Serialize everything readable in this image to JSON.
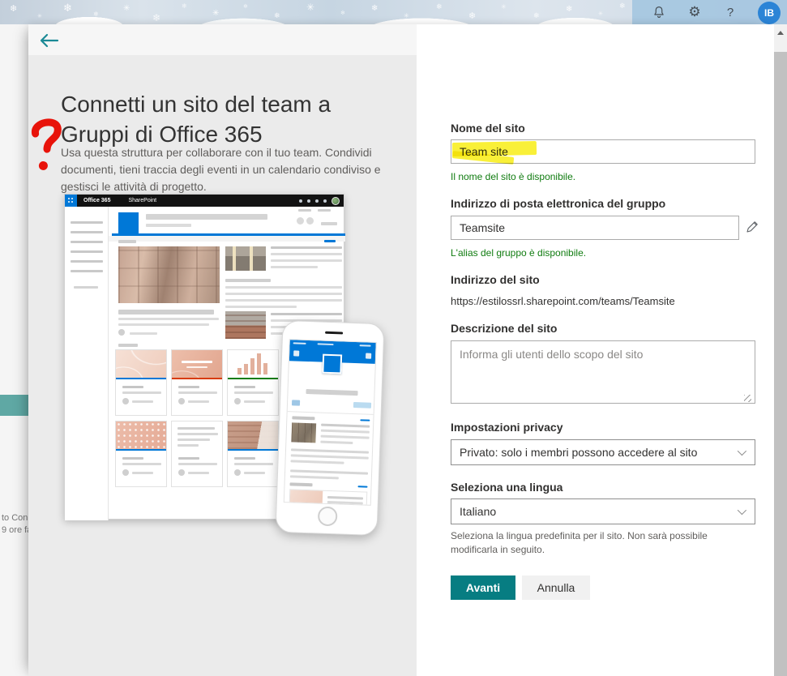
{
  "top_bar": {
    "help_label": "?",
    "avatar_initials": "IB",
    "icons": [
      "bell-icon",
      "gear-icon",
      "help-icon"
    ]
  },
  "background_page": {
    "peek_line1": "to Con",
    "peek_line2": "9 ore fa"
  },
  "left_panel": {
    "title": "Connetti un sito del team a Gruppi di Office 365",
    "description": "Usa questa struttura per collaborare con il tuo team. Condividi documenti, tieni traccia degli eventi in un calendario condiviso e gestisci le attività di progetto.",
    "preview": {
      "suite_label": "Office 365",
      "app_label": "SharePoint"
    }
  },
  "form": {
    "site_name": {
      "label": "Nome del sito",
      "value": "Team site",
      "validation": "Il nome del sito è disponibile."
    },
    "group_email": {
      "label": "Indirizzo di posta elettronica del gruppo",
      "value": "Teamsite",
      "validation": "L'alias del gruppo è disponibile."
    },
    "site_address": {
      "label": "Indirizzo del sito",
      "value": "https://estilossrl.sharepoint.com/teams/Teamsite"
    },
    "site_description": {
      "label": "Descrizione del sito",
      "placeholder": "Informa gli utenti dello scopo del sito"
    },
    "privacy": {
      "label": "Impostazioni privacy",
      "value": "Privato: solo i membri possono accedere al sito"
    },
    "language": {
      "label": "Seleziona una lingua",
      "value": "Italiano",
      "help": "Seleziona la lingua predefinita per il sito. Non sarà possibile modificarla in seguito."
    },
    "next_label": "Avanti",
    "cancel_label": "Annulla"
  },
  "colors": {
    "accent_teal": "#077d82",
    "success_green": "#107c10",
    "brand_blue": "#0078d7",
    "highlight_yellow": "#f8ee15",
    "annotation_red": "#e8130a"
  }
}
